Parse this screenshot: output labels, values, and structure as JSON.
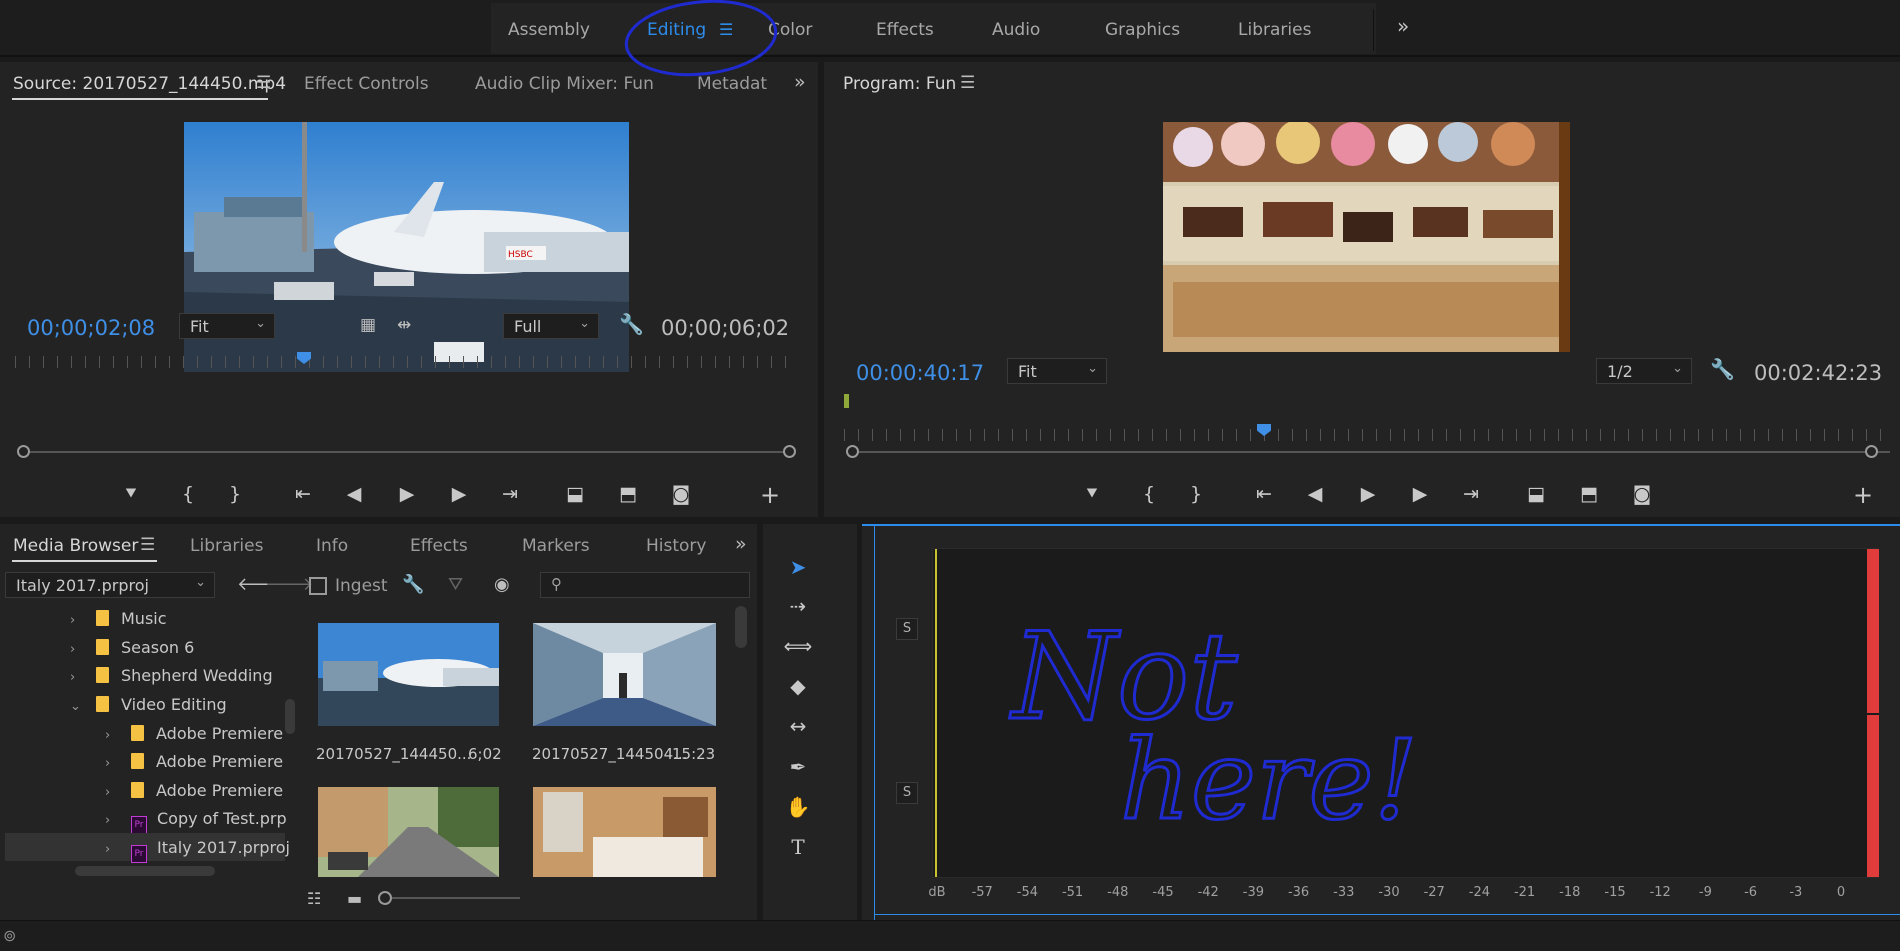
{
  "workspaces": [
    "Assembly",
    "Editing",
    "Color",
    "Effects",
    "Audio",
    "Graphics",
    "Libraries"
  ],
  "workspace_active": "Editing",
  "workspace_overflow": "»",
  "source_panel": {
    "tabs": [
      "Source: 20170527_144450.mp4",
      "Effect Controls",
      "Audio Clip Mixer: Fun",
      "Metadat"
    ],
    "timecode_in": "00;00;02;08",
    "timecode_duration": "00;00;06;02",
    "zoom": "Fit",
    "resolution": "Full"
  },
  "program_panel": {
    "title": "Program: Fun",
    "timecode_in": "00:00:40:17",
    "timecode_duration": "00:02:42:23",
    "zoom": "Fit",
    "resolution": "1/2"
  },
  "media_browser": {
    "tabs": [
      "Media Browser",
      "Libraries",
      "Info",
      "Effects",
      "Markers",
      "History"
    ],
    "project": "Italy 2017.prproj",
    "ingest_label": "Ingest",
    "tree": [
      {
        "label": "Music",
        "type": "folder",
        "indent": 0,
        "expanded": false
      },
      {
        "label": "Season 6",
        "type": "folder",
        "indent": 0,
        "expanded": false
      },
      {
        "label": "Shepherd Wedding",
        "type": "folder",
        "indent": 0,
        "expanded": false
      },
      {
        "label": "Video Editing",
        "type": "folder",
        "indent": 0,
        "expanded": true
      },
      {
        "label": "Adobe Premiere",
        "type": "folder",
        "indent": 1,
        "expanded": false
      },
      {
        "label": "Adobe Premiere",
        "type": "folder",
        "indent": 1,
        "expanded": false
      },
      {
        "label": "Adobe Premiere",
        "type": "folder",
        "indent": 1,
        "expanded": false
      },
      {
        "label": "Copy of Test.prp",
        "type": "project",
        "indent": 1,
        "expanded": false
      },
      {
        "label": "Italy 2017.prproj",
        "type": "project",
        "indent": 1,
        "expanded": false
      }
    ],
    "clips": [
      {
        "name": "20170527_144450...",
        "duration": "6;02"
      },
      {
        "name": "20170527_144504...",
        "duration": "15:23"
      }
    ]
  },
  "audio_meter": {
    "solo_labels": [
      "S",
      "S"
    ],
    "db_labels": [
      "dB",
      "-57",
      "-54",
      "-51",
      "-48",
      "-45",
      "-42",
      "-39",
      "-36",
      "-33",
      "-30",
      "-27",
      "-24",
      "-21",
      "-18",
      "-15",
      "-12",
      "-9",
      "-6",
      "-3",
      "0"
    ]
  },
  "annotation_text": [
    "Not",
    "here!"
  ],
  "colors": {
    "accent": "#3f8fe6",
    "annotation_ink": "#1f2bd1",
    "meter_peak": "#e03c3c",
    "folder": "#f5c243"
  }
}
